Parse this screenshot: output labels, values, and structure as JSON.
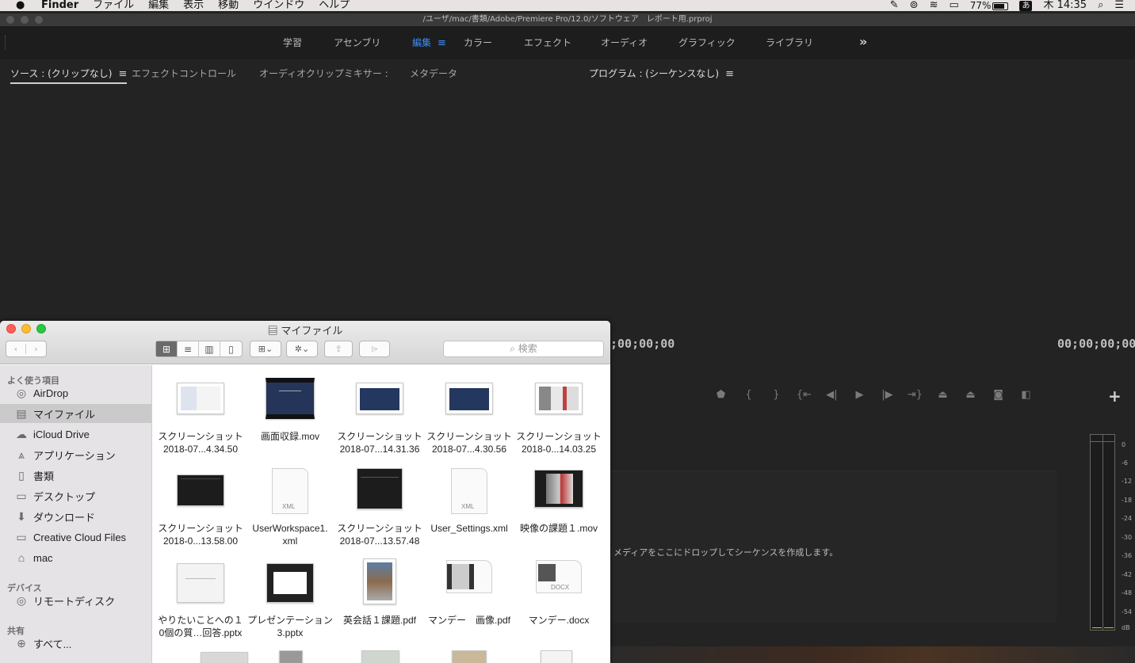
{
  "menubar": {
    "apple": "",
    "app": "Finder",
    "items": [
      "ファイル",
      "編集",
      "表示",
      "移動",
      "ウインドウ",
      "ヘルプ"
    ],
    "battery": "77%",
    "input": "あ",
    "clock": "木 14:35"
  },
  "premiere": {
    "title": "/ユーザ/mac/書類/Adobe/Premiere Pro/12.0/ソフトウェア　レポート用.prproj",
    "workspaces": [
      "学習",
      "アセンブリ",
      "編集",
      "カラー",
      "エフェクト",
      "オーディオ",
      "グラフィック",
      "ライブラリ"
    ],
    "active_workspace": "編集",
    "more": "»",
    "source_tabs": [
      "ソース : (クリップなし)",
      "エフェクトコントロール",
      "オーディオクリップミキサー :",
      "メタデータ"
    ],
    "program_tab": "プログラム : (シーケンスなし)",
    "timecode_left": ";00;00;00",
    "timecode_right": "00;00;00;00",
    "drop_hint": "メディアをここにドロップしてシーケンスを作成します。",
    "meter_scale": [
      "0",
      "-6",
      "-12",
      "-18",
      "-24",
      "-30",
      "-36",
      "-42",
      "-48",
      "-54",
      "dB"
    ]
  },
  "finder": {
    "title": "マイファイル",
    "search_placeholder": "検索",
    "sidebar": {
      "favorites_header": "よく使う項目",
      "favorites": [
        {
          "label": "AirDrop",
          "icon": "airdrop-icon"
        },
        {
          "label": "マイファイル",
          "icon": "all-files-icon",
          "selected": true
        },
        {
          "label": "iCloud Drive",
          "icon": "cloud-icon"
        },
        {
          "label": "アプリケーション",
          "icon": "applications-icon"
        },
        {
          "label": "書類",
          "icon": "documents-icon"
        },
        {
          "label": "デスクトップ",
          "icon": "desktop-icon"
        },
        {
          "label": "ダウンロード",
          "icon": "download-icon"
        },
        {
          "label": "Creative Cloud Files",
          "icon": "folder-icon"
        },
        {
          "label": "mac",
          "icon": "home-icon"
        }
      ],
      "devices_header": "デバイス",
      "devices": [
        {
          "label": "リモートディスク",
          "icon": "disc-icon"
        }
      ],
      "shared_header": "共有",
      "shared": [
        {
          "label": "すべて...",
          "icon": "network-icon"
        }
      ]
    },
    "files": [
      {
        "line1": "スクリーンショット",
        "line2": "2018-07...4.34.50",
        "kind": "screenshot-light"
      },
      {
        "line1": "画面収録.mov",
        "line2": "",
        "kind": "movie-navy"
      },
      {
        "line1": "スクリーンショット",
        "line2": "2018-07...14.31.36",
        "kind": "screenshot-navy"
      },
      {
        "line1": "スクリーンショット",
        "line2": "2018-07...4.30.56",
        "kind": "screenshot-navy"
      },
      {
        "line1": "スクリーンショット",
        "line2": "2018-0...14.03.25",
        "kind": "screenshot-web"
      },
      {
        "line1": "スクリーンショット",
        "line2": "2018-0...13.58.00",
        "kind": "screenshot-dark"
      },
      {
        "line1": "UserWorkspace1.",
        "line2": "xml",
        "kind": "xml",
        "badge": "XML"
      },
      {
        "line1": "スクリーンショット",
        "line2": "2018-07...13.57.48",
        "kind": "screenshot-dark"
      },
      {
        "line1": "User_Settings.xml",
        "line2": "",
        "kind": "xml",
        "badge": "XML"
      },
      {
        "line1": "映像の課題１.mov",
        "line2": "",
        "kind": "movie-dark"
      },
      {
        "line1": "やりたいことへの１",
        "line2": "0個の質…回答.pptx",
        "kind": "pptx-light"
      },
      {
        "line1": "プレゼンテーション",
        "line2": "3.pptx",
        "kind": "pptx-pattern"
      },
      {
        "line1": "英会話１課題.pdf",
        "line2": "",
        "kind": "pdf-photo"
      },
      {
        "line1": "マンデー　画像.pdf",
        "line2": "",
        "kind": "pdf-film"
      },
      {
        "line1": "マンデー.docx",
        "line2": "",
        "kind": "docx",
        "badge": "DOCX"
      }
    ]
  }
}
